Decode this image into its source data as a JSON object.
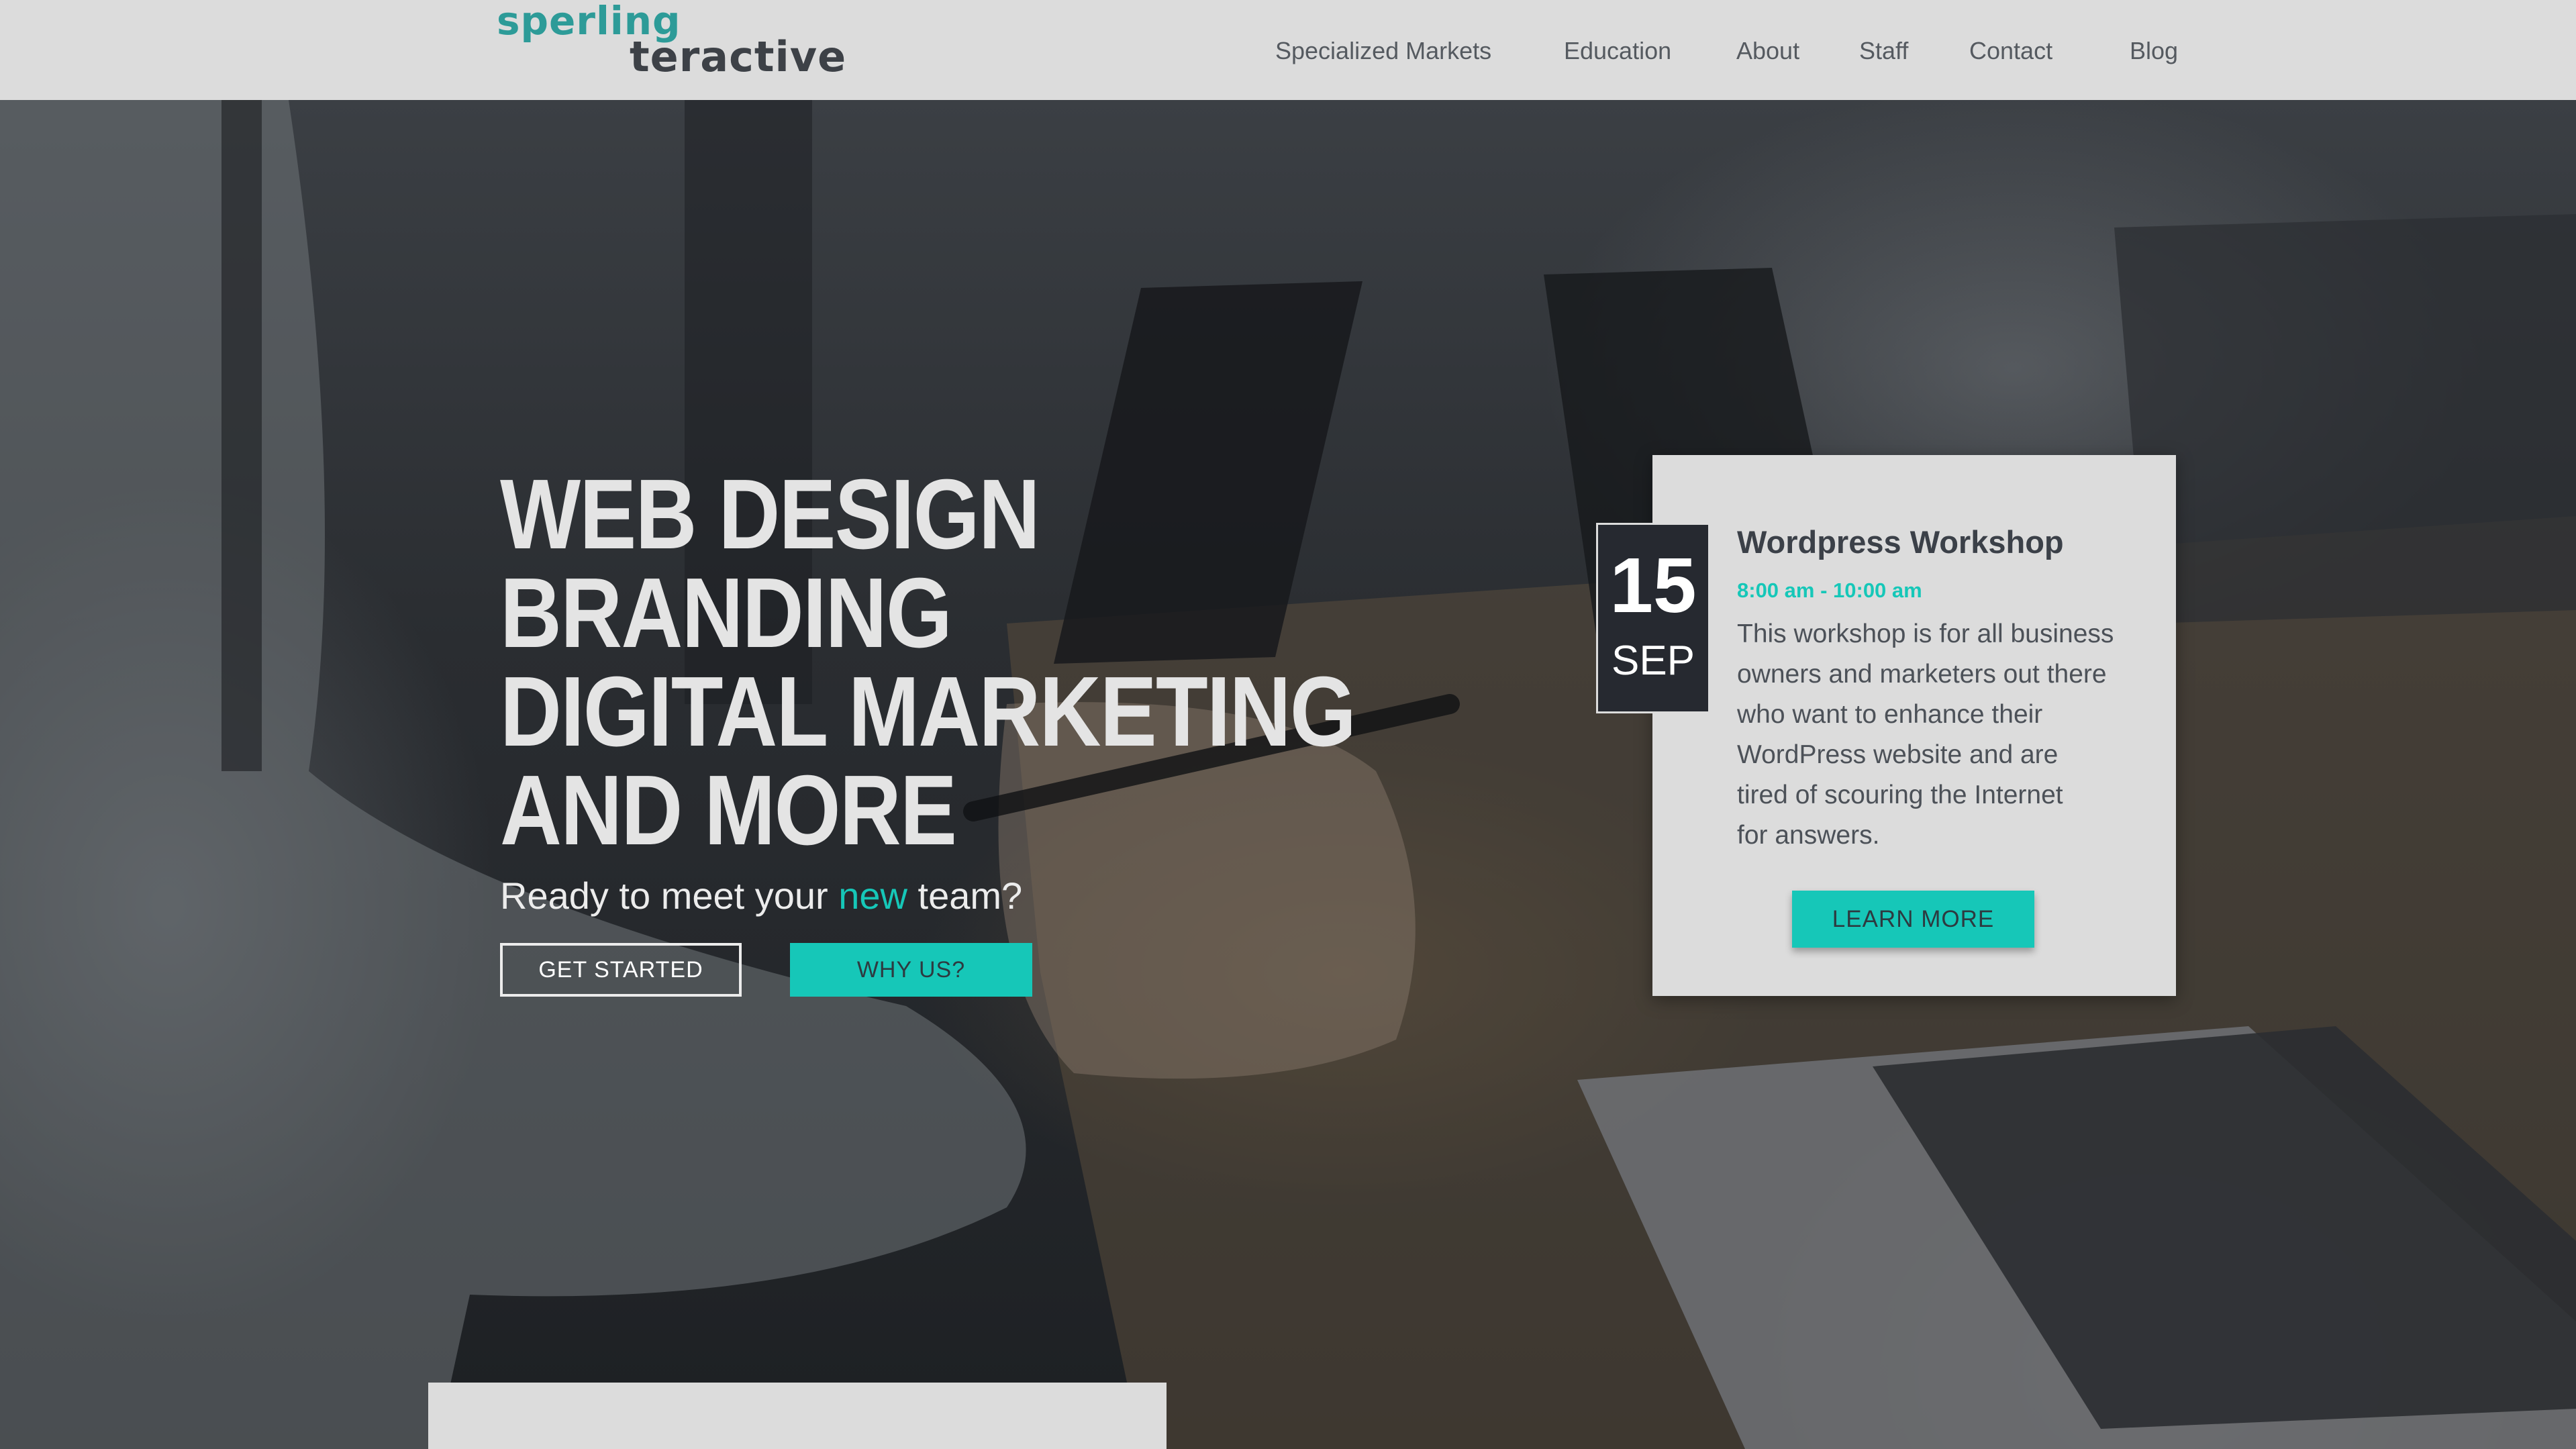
{
  "brand": {
    "logo_line1": "sperling",
    "logo_line2": "teractive",
    "primary_color": "#2d9b98",
    "accent_color": "#16c7b8"
  },
  "nav": {
    "items": [
      {
        "label": "Specialized Markets"
      },
      {
        "label": "Education"
      },
      {
        "label": "About"
      },
      {
        "label": "Staff"
      },
      {
        "label": "Contact"
      },
      {
        "label": "Blog"
      }
    ]
  },
  "hero": {
    "headline_lines": [
      "WEB DESIGN",
      "BRANDING",
      "DIGITAL MARKETING",
      "AND MORE"
    ],
    "tagline_before": "Ready to meet your ",
    "tagline_accent": "new",
    "tagline_after": " team?",
    "primary_cta": "GET STARTED",
    "secondary_cta": "WHY US?"
  },
  "event": {
    "day": "15",
    "month": "SEP",
    "title": "Wordpress Workshop",
    "time": "8:00 am - 10:00 am",
    "description_lines": [
      "This workshop is for all business",
      "owners and marketers out there",
      "who want to enhance their",
      "WordPress website and are",
      "tired of scouring the Internet",
      "for answers."
    ],
    "cta": "LEARN MORE"
  }
}
